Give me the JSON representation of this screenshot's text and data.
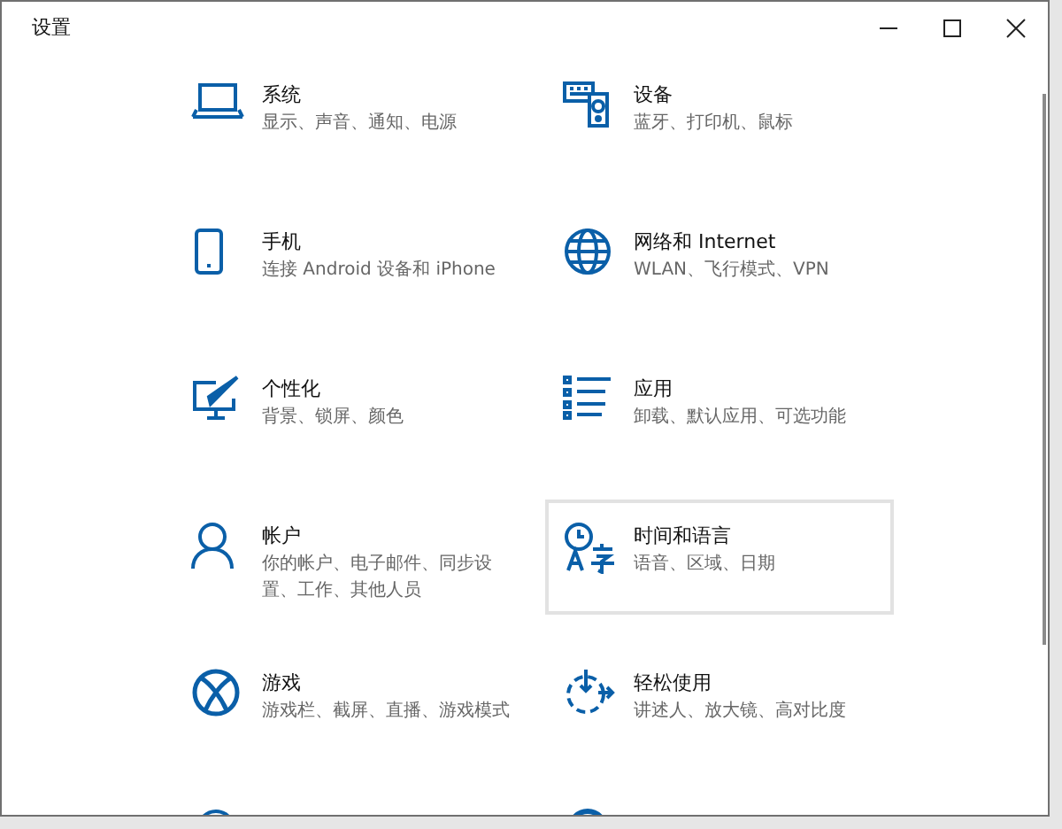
{
  "window": {
    "title": "设置"
  },
  "tiles": [
    {
      "title": "系统",
      "subtitle": "显示、声音、通知、电源",
      "selected": false
    },
    {
      "title": "设备",
      "subtitle": "蓝牙、打印机、鼠标",
      "selected": false
    },
    {
      "title": "手机",
      "subtitle": "连接 Android 设备和 iPhone",
      "selected": false
    },
    {
      "title": "网络和 Internet",
      "subtitle": "WLAN、飞行模式、VPN",
      "selected": false
    },
    {
      "title": "个性化",
      "subtitle": "背景、锁屏、颜色",
      "selected": false
    },
    {
      "title": "应用",
      "subtitle": "卸载、默认应用、可选功能",
      "selected": false
    },
    {
      "title": "帐户",
      "subtitle": "你的帐户、电子邮件、同步设置、工作、其他人员",
      "selected": false
    },
    {
      "title": "时间和语言",
      "subtitle": "语音、区域、日期",
      "selected": true
    },
    {
      "title": "游戏",
      "subtitle": "游戏栏、截屏、直播、游戏模式",
      "selected": false
    },
    {
      "title": "轻松使用",
      "subtitle": "讲述人、放大镜、高对比度",
      "selected": false
    }
  ]
}
